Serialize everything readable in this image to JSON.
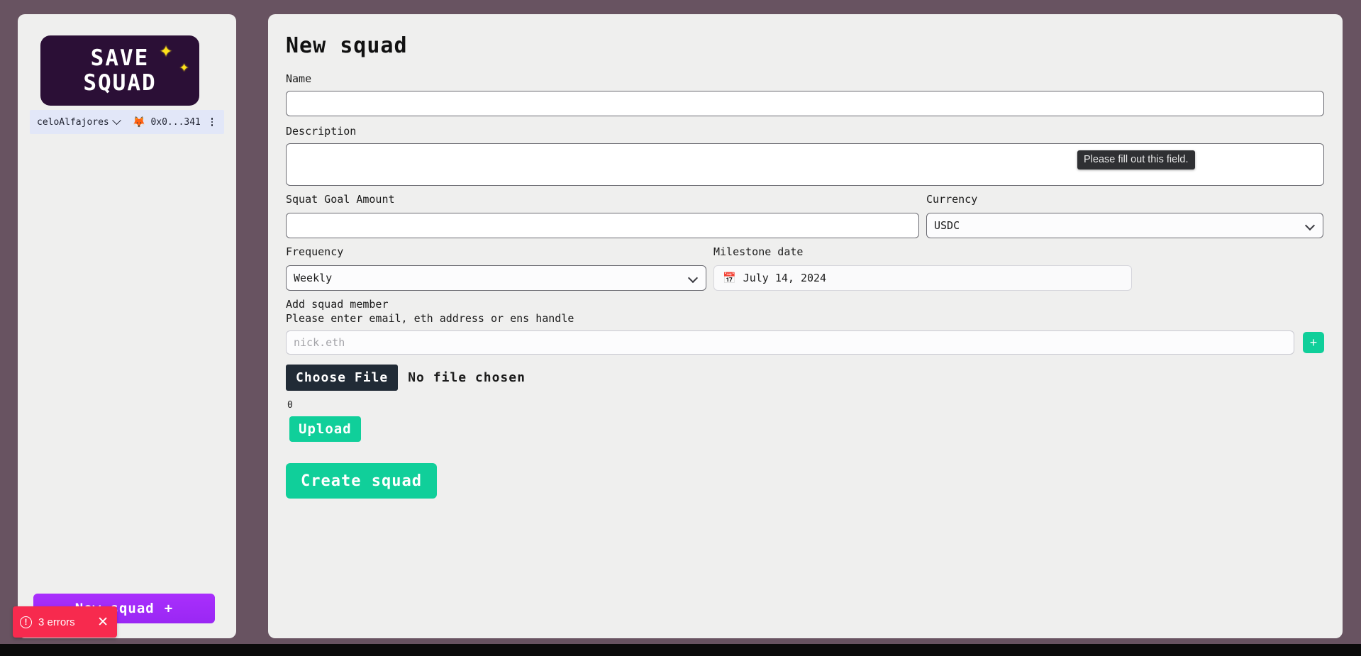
{
  "theme": {
    "page_bg": "#685361",
    "card_bg": "#efefee",
    "accent_green": "#10cf9a",
    "accent_purple": "#a32ffa",
    "logo_bg": "#2b0f36",
    "error_red": "#f72a4e",
    "dark_button": "#212b36"
  },
  "sidebar": {
    "logo": {
      "line1": "SAVE",
      "line2": "SQUAD",
      "sparkle1": "✦",
      "sparkle2": "✦"
    },
    "wallet": {
      "network": "celoAlfajores",
      "network_chevron": "chevron-down",
      "account_icon": "🦊",
      "address": "0x0...341",
      "menu_icon": "vertical-dots"
    },
    "new_squad_button": {
      "label": "New squad",
      "plus": "+"
    }
  },
  "main": {
    "title": "New squad",
    "fields": {
      "name": {
        "label": "Name",
        "value": "",
        "placeholder": ""
      },
      "description": {
        "label": "Description",
        "value": "",
        "placeholder": ""
      },
      "squat_goal_amount": {
        "label": "Squat Goal Amount",
        "value": "",
        "placeholder": ""
      },
      "currency": {
        "label": "Currency",
        "selected": "USDC",
        "options": [
          "USDC"
        ]
      },
      "frequency": {
        "label": "Frequency",
        "selected": "Weekly",
        "options": [
          "Weekly"
        ]
      },
      "milestone_date": {
        "label": "Milestone date",
        "value": "July 14, 2024",
        "icon": "calendar-icon"
      },
      "add_member": {
        "label": "Add squad member",
        "hint": "Please enter email, eth address or ens handle",
        "value": "",
        "placeholder": "nick.eth",
        "add_button": "+"
      },
      "file": {
        "choose_label": "Choose File",
        "status": "No file chosen",
        "count": "0",
        "upload_label": "Upload"
      }
    },
    "submit_button": "Create squad"
  },
  "tooltip": {
    "text": "Please fill out this field."
  },
  "toast": {
    "icon": "!",
    "text": "3 errors",
    "close": "✕"
  }
}
